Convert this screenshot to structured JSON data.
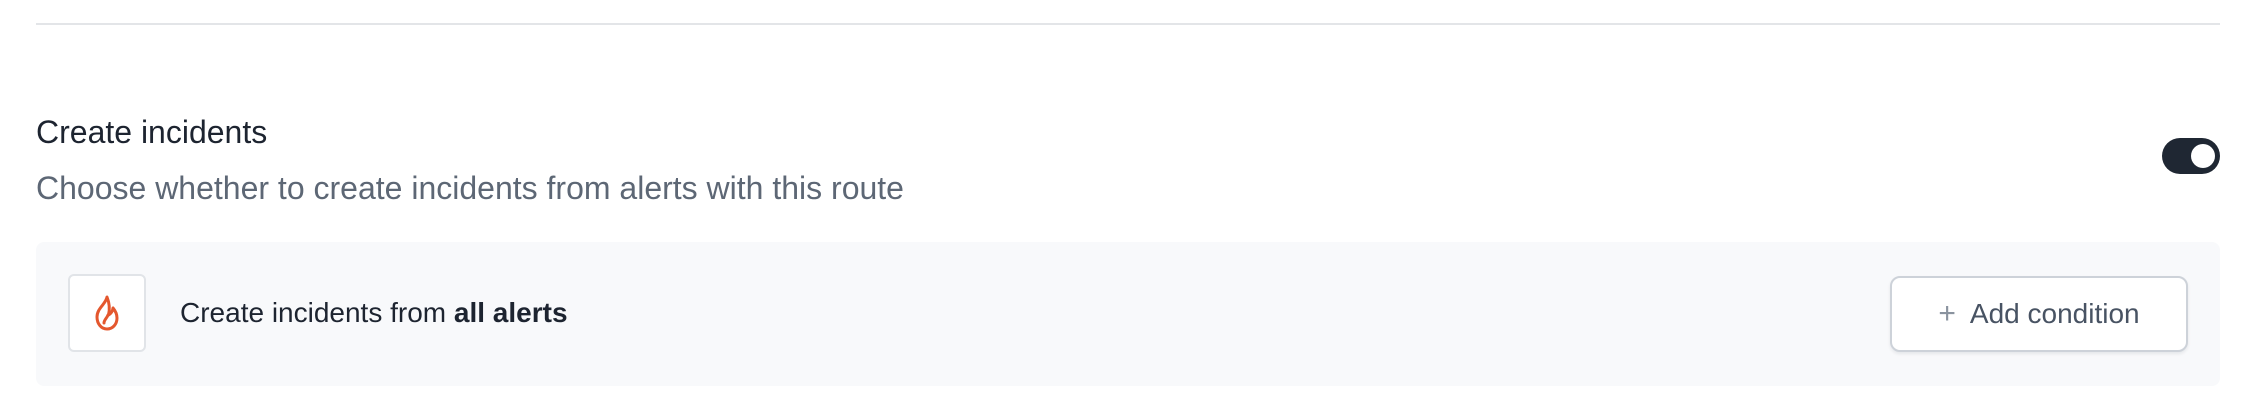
{
  "section": {
    "title": "Create incidents",
    "description": "Choose whether to create incidents from alerts with this route",
    "toggle_on": true
  },
  "condition": {
    "icon": "fire-icon",
    "icon_color": "#e4572e",
    "prefix": "Create incidents from ",
    "emphasis": "all alerts",
    "button_icon": "plus-icon",
    "button_label": "Add condition"
  },
  "colors": {
    "toggle_active": "#1f2733",
    "panel_background": "#f8f9fb"
  }
}
